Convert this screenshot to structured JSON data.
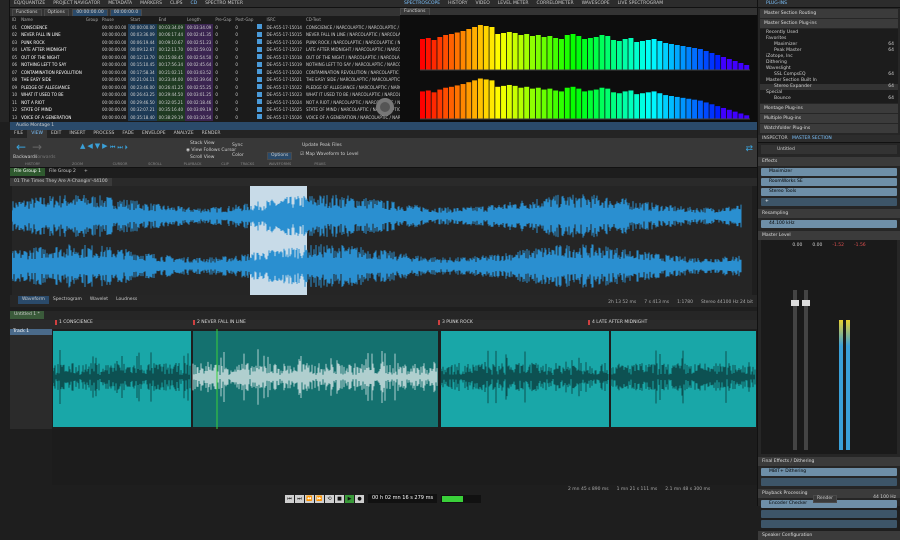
{
  "top_tabs": [
    "EQ/QUANTIZE",
    "PROJECT NAVIGATOR",
    "METADATA",
    "MARKERS",
    "CLIPS",
    "CD",
    "SPECTRO METER"
  ],
  "toolbar": {
    "functions": "Functions",
    "options": "Options",
    "time": "00:00:00.00",
    "length": "00:00:00.0"
  },
  "cd_table": {
    "columns": [
      "ID",
      "Name",
      "Group",
      "Pause",
      "Start",
      "End",
      "Length",
      "Pre-Gap",
      "Post-Gap",
      "",
      "ISRC",
      "CD-Text",
      "Comment"
    ],
    "rows": [
      [
        "01",
        "CONSCIENCE",
        "",
        "00:00:00.00",
        "00:00:00.00",
        "00:03:34.09",
        "00:03:34.09",
        "0",
        "0",
        "DE-A55-17-15014",
        "CONSCIENCE / NARCOLAPTIC / NARCOLAPTIC / NARCOLAPTIC"
      ],
      [
        "02",
        "NEVER FALL IN LINE",
        "",
        "00:00:00.00",
        "00:03:36.09",
        "00:06:17.44",
        "00:02:41.35",
        "0",
        "0",
        "DE-A55-17-15015",
        "NEVER FALL IN LINE / NARCOLAPTIC / NARCOLAPTIC"
      ],
      [
        "03",
        "PUNK ROCK",
        "",
        "00:00:00.00",
        "00:06:19.44",
        "00:09:10.67",
        "00:02:51.23",
        "0",
        "0",
        "DE-A55-17-15016",
        "PUNK ROCK / NARCOLAPTIC / NARCOLAPTIC / NARCOLAPTIC"
      ],
      [
        "04",
        "LATE AFTER MIDNIGHT",
        "",
        "00:00:00.00",
        "00:09:12.67",
        "00:12:11.70",
        "00:02:59.03",
        "0",
        "0",
        "DE-A55-17-15017",
        "LATE AFTER MIDNIGHT / NARCOLAPTIC / NARCOLAPTIC"
      ],
      [
        "05",
        "OUT OF THE NIGHT",
        "",
        "00:00:00.00",
        "00:12:13.70",
        "00:15:08.45",
        "00:02:54.50",
        "0",
        "0",
        "DE-A55-17-15018",
        "OUT OF THE NIGHT / NARCOLAPTIC / NARCOLAPTIC"
      ],
      [
        "06",
        "NOTHING LEFT TO SAY",
        "",
        "00:00:00.00",
        "00:15:10.45",
        "00:17:56.34",
        "00:02:45.64",
        "0",
        "0",
        "DE-A55-17-15019",
        "NOTHING LEFT TO SAY / NARCOLAPTIC / NARCOLAPTIC"
      ],
      [
        "07",
        "CONTAMINATION REVOLUTION",
        "",
        "00:00:00.00",
        "00:17:58.34",
        "00:21:02.11",
        "00:03:03.52",
        "0",
        "0",
        "DE-A55-17-15020",
        "CONTAMINATION REVOLUTION / NARCOLAPTIC / NARCOLAPTIC"
      ],
      [
        "08",
        "THE EASY SIDE",
        "",
        "00:00:00.00",
        "00:21:04.11",
        "00:23:44.00",
        "00:02:39.64",
        "0",
        "0",
        "DE-A55-17-15021",
        "THE EASY SIDE / NARCOLAPTIC / NARCOLAPTIC / N..."
      ],
      [
        "09",
        "PLEDGE OF ALLEGIANCE",
        "",
        "00:00:00.00",
        "00:23:46.00",
        "00:26:41.25",
        "00:02:55.25",
        "0",
        "0",
        "DE-A55-17-15022",
        "PLEDGE OF ALLEGIANCE / NARCOLAPTIC / NARCOLAPTIC"
      ],
      [
        "10",
        "WHAT IT USED TO BE",
        "",
        "00:00:00.00",
        "00:26:43.25",
        "00:29:44.50",
        "00:03:01.25",
        "0",
        "0",
        "DE-A55-17-15023",
        "WHAT IT USED TO BE / NARCOLAPTIC / NARCOLAPTIC"
      ],
      [
        "11",
        "NOT A RIOT",
        "",
        "00:00:00.00",
        "00:29:46.50",
        "00:32:05.21",
        "00:02:18.46",
        "0",
        "0",
        "DE-A55-17-15024",
        "NOT A RIOT / NARCOLAPTIC / NARCOLAPTIC / NARCOLAPTIC"
      ],
      [
        "12",
        "STATE OF MIND",
        "",
        "00:00:00.00",
        "00:32:07.21",
        "00:35:16.40",
        "00:03:09.19",
        "0",
        "0",
        "DE-A55-17-15025",
        "STATE OF MIND / NARCOLAPTIC / NARCOLAPTIC / N..."
      ],
      [
        "13",
        "VOICE OF A GENERATION",
        "",
        "00:00:00.00",
        "00:35:18.40",
        "00:38:29.19",
        "00:03:10.54",
        "0",
        "0",
        "DE-A55-17-15026",
        "VOICE OF A GENERATION / NARCOLAPTIC / NARCOLAPTIC"
      ]
    ]
  },
  "meter_tabs": [
    "SPECTROSCOPE",
    "HISTORY",
    "VIDEO",
    "LEVEL METER",
    "CORRELOMETER",
    "WAVESCOPE",
    "LIVE SPECTROGRAM"
  ],
  "meter_functions": "Functions",
  "spectrum": {
    "top": [
      62,
      64,
      60,
      66,
      70,
      72,
      75,
      78,
      82,
      86,
      90,
      88,
      86,
      72,
      74,
      76,
      74,
      70,
      72,
      68,
      70,
      66,
      68,
      64,
      62,
      70,
      72,
      68,
      62,
      64,
      66,
      70,
      68,
      60,
      58,
      62,
      64,
      56,
      58,
      60,
      62,
      58,
      54,
      52,
      50,
      48,
      46,
      44,
      42,
      38,
      34,
      30,
      26,
      22,
      18,
      14,
      10
    ],
    "bottom": [
      60,
      62,
      58,
      64,
      68,
      70,
      73,
      76,
      80,
      84,
      88,
      86,
      84,
      70,
      72,
      74,
      72,
      68,
      70,
      66,
      68,
      64,
      66,
      62,
      60,
      68,
      70,
      66,
      60,
      62,
      64,
      68,
      66,
      58,
      56,
      60,
      62,
      54,
      56,
      58,
      60,
      56,
      52,
      50,
      48,
      46,
      44,
      42,
      40,
      36,
      32,
      28,
      24,
      20,
      16,
      12,
      8
    ]
  },
  "montage_title": "Audio Montage 1",
  "ribbon_tabs": [
    "FILE",
    "VIEW",
    "EDIT",
    "INSERT",
    "PROCESS",
    "FADE",
    "ENVELOPE",
    "ANALYZE",
    "RENDER"
  ],
  "ribbon": {
    "backwards": "Backwards",
    "forwards": "Forwards",
    "stack_view": "Stack View",
    "view_follows": "View Follows Cursor",
    "scroll_view": "Scroll View",
    "sync": "Sync",
    "color": "Color",
    "options": "Options",
    "update_peak": "Update Peak Files",
    "map_waveform": "Map Waveform to Level",
    "groups": [
      "HISTORY",
      "ZOOM",
      "CURSOR",
      "SCROLL",
      "PLAYBACK",
      "CLIP",
      "TRACKS",
      "WAVEFORMS",
      "PEAKS"
    ]
  },
  "file_groups": [
    "File Group 1",
    "File Group 2"
  ],
  "wave_title": "01 The Times They Are A-Changin'-44100",
  "wave_bottom": {
    "views": [
      "Waveform",
      "Spectrogram",
      "Wavelet",
      "Loudness"
    ],
    "readouts": [
      "2h 13 52 ms",
      "7 s 413 ms",
      "1:1780",
      "Stereo 44100 Hz 24 bit"
    ]
  },
  "montage_tab": "Untitled 1 *",
  "track_label": "Track 1",
  "markers": [
    "1 CONSCIENCE",
    "2 NEVER FALL IN LINE",
    "3 PUNK ROCK",
    "4 LATE AFTER MIDNIGHT"
  ],
  "montage_readouts": [
    "2 mn 45 s 890 ms",
    "1 mn 21 s 111 ms",
    "2.1 mn 48 s 300 ms"
  ],
  "transport": {
    "time": "00 h 02 mn 16 s 279 ms",
    "level": 0.55
  },
  "right": {
    "plugins_title": "PLUG-INS",
    "plugin_sections": [
      "Master Section Routing",
      "Master Section Plug-ins"
    ],
    "plugin_tree": [
      [
        "Recently Used",
        ""
      ],
      [
        "Favorites",
        ""
      ],
      [
        "Maximizer",
        "64"
      ],
      [
        "Peak Master",
        "64"
      ],
      [
        "iZotope, Inc",
        ""
      ],
      [
        "Dithering",
        ""
      ],
      [
        "Waveslight",
        ""
      ],
      [
        "SSL CompsEQ",
        "64"
      ],
      [
        "Master Section Built In",
        ""
      ],
      [
        "Stereo Expander",
        "64"
      ],
      [
        "Special",
        ""
      ],
      [
        "Bounce",
        "64"
      ]
    ],
    "plugin_rows": [
      "Montage Plug-ins",
      "Multiple Plug-ins",
      "Watchfolder Plug-ins"
    ],
    "inspector_tabs": [
      "INSPECTOR",
      "MASTER SECTION"
    ],
    "preset": "Untitled",
    "effects_label": "Effects",
    "effects": [
      "Maximizer",
      "RoomWorks SE",
      "Stereo Tools"
    ],
    "resampling_label": "Resampling",
    "resampling": "44.100 kHz",
    "master_level_label": "Master Level",
    "levels": [
      "0.00",
      "0.00",
      "-1.52",
      "-1.56"
    ],
    "final_label": "Final Effects / Dithering",
    "final": "MBIT+ Dithering",
    "playback_label": "Playback Processing",
    "playback": "Encoder Checker",
    "speaker_label": "Speaker Configuration",
    "render": "Render",
    "rate": "44 100 Hz"
  },
  "colors": {
    "accent": "#3aa0d8",
    "wave": "#2a8fd0",
    "clip": "#19a7a8",
    "clip_dark": "#14716f",
    "play": "#3ad03a"
  }
}
